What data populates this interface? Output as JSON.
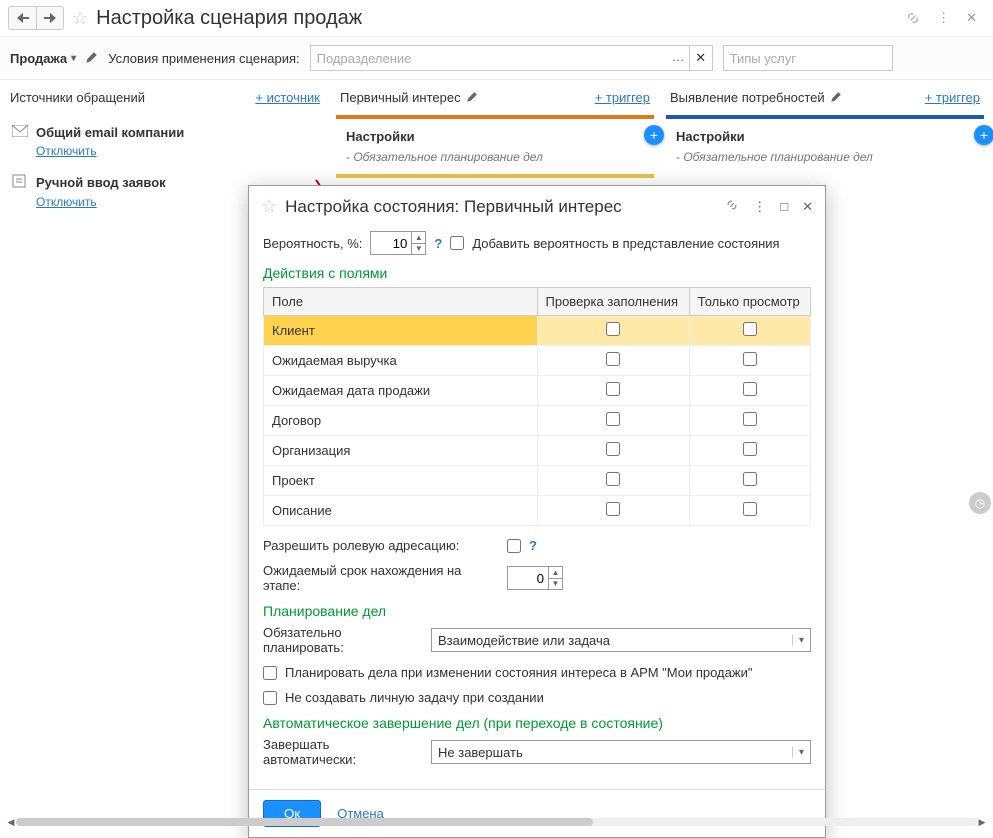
{
  "header": {
    "title": "Настройка сценария продаж"
  },
  "cond": {
    "tag": "Продажа",
    "label": "Условия применения сценария:",
    "sub_placeholder": "Подразделение",
    "types_placeholder": "Типы услуг"
  },
  "col_sources": {
    "title": "Источники обращений",
    "link": "+ источник"
  },
  "col_primary": {
    "title": "Первичный интерес",
    "link": "+ триггер",
    "settings_label": "Настройки",
    "rule": "Обязательное планирование дел"
  },
  "col_need": {
    "title": "Выявление потребностей",
    "link": "+ триггер",
    "settings_label": "Настройки",
    "rule": "Обязательное планирование дел"
  },
  "sources": [
    {
      "name": "Общий email компании",
      "off": "Отключить",
      "icon": "mail"
    },
    {
      "name": "Ручной ввод заявок",
      "off": "Отключить",
      "icon": "form"
    }
  ],
  "dialog": {
    "title": "Настройка состояния: Первичный интерес",
    "prob_label": "Вероятность, %:",
    "prob_value": "10",
    "add_prob_label": "Добавить вероятность в представление состояния",
    "section_fields": "Действия с полями",
    "th_field": "Поле",
    "th_check": "Проверка заполнения",
    "th_ro": "Только просмотр",
    "rows": [
      "Клиент",
      "Ожидаемая выручка",
      "Ожидаемая дата продажи",
      "Договор",
      "Организация",
      "Проект",
      "Описание"
    ],
    "role_label": "Разрешить ролевую адресацию:",
    "expected_label": "Ожидаемый срок нахождения на этапе:",
    "expected_value": "0",
    "section_plan": "Планирование дел",
    "plan_label": "Обязательно планировать:",
    "plan_value": "Взаимодействие или задача",
    "plan_chk1": "Планировать дела при изменении состояния интереса в АРМ \"Мои продажи\"",
    "plan_chk2": "Не создавать личную задачу при создании",
    "section_auto": "Автоматическое завершение дел (при  переходе в  состояние)",
    "auto_label": "Завершать автоматически:",
    "auto_value": "Не завершать",
    "ok": "Ок",
    "cancel": "Отмена"
  }
}
